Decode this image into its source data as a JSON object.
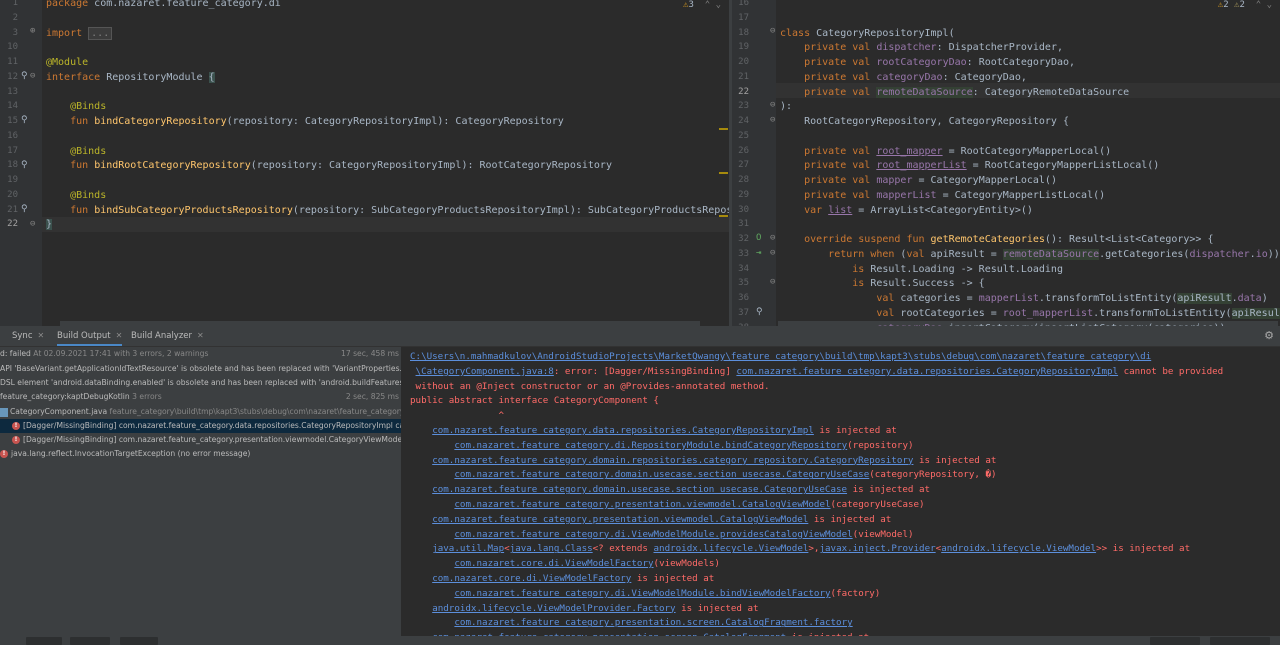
{
  "left_editor": {
    "inspection": {
      "count": "3"
    },
    "lines": [
      {
        "num": "1",
        "html": "<span class=\"kw\">package </span>com.nazaret.feature_category.di"
      },
      {
        "num": "2",
        "html": ""
      },
      {
        "num": "3",
        "html": "<span class=\"kw\">import </span><span class=\"fold\">...</span>"
      },
      {
        "num": "10",
        "html": ""
      },
      {
        "num": "11",
        "html": "<span class=\"ann\">@Module</span>"
      },
      {
        "num": "12",
        "html": "<span class=\"kw\">interface </span>RepositoryModule <span class=\"bracehl\">{</span>"
      },
      {
        "num": "13",
        "html": ""
      },
      {
        "num": "14",
        "html": "    <span class=\"ann\">@Binds</span>"
      },
      {
        "num": "15",
        "html": "    <span class=\"kw\">fun </span><span class=\"fn\">bindCategoryRepository</span>(repository: CategoryRepositoryImpl): CategoryRepository"
      },
      {
        "num": "16",
        "html": ""
      },
      {
        "num": "17",
        "html": "    <span class=\"ann\">@Binds</span>"
      },
      {
        "num": "18",
        "html": "    <span class=\"kw\">fun </span><span class=\"fn\">bindRootCategoryRepository</span>(repository: CategoryRepositoryImpl): RootCategoryRepository"
      },
      {
        "num": "19",
        "html": ""
      },
      {
        "num": "20",
        "html": "    <span class=\"ann\">@Binds</span>"
      },
      {
        "num": "21",
        "html": "    <span class=\"kw\">fun </span><span class=\"fn\">bindSubCategoryProductsRepository</span>(repository: SubCategoryProductsRepositoryImpl): SubCategoryProductsRepository"
      },
      {
        "num": "22",
        "html": "<span class=\"bracehl\">}</span>"
      }
    ]
  },
  "right_editor": {
    "inspection": {
      "warnings": "2",
      "weak_warnings": "2"
    },
    "lines": [
      {
        "num": "16",
        "html": ""
      },
      {
        "num": "17",
        "html": ""
      },
      {
        "num": "18",
        "html": "<span class=\"kw\">class </span>CategoryRepositoryImpl("
      },
      {
        "num": "19",
        "html": "    <span class=\"kw\">private val </span><span class=\"prop\">dispatcher</span>: DispatcherProvider,"
      },
      {
        "num": "20",
        "html": "    <span class=\"kw\">private val </span><span class=\"prop\">rootCategoryDao</span>: RootCategoryDao,"
      },
      {
        "num": "21",
        "html": "    <span class=\"kw\">private val </span><span class=\"prop\">categoryDao</span>: CategoryDao,"
      },
      {
        "num": "22",
        "html": "    <span class=\"kw\">private val </span><span class=\"prop hl\">remoteDataSource</span>: CategoryRemoteDataSource"
      },
      {
        "num": "23",
        "html": "):"
      },
      {
        "num": "24",
        "html": "    RootCategoryRepository, CategoryRepository {"
      },
      {
        "num": "25",
        "html": ""
      },
      {
        "num": "26",
        "html": "    <span class=\"kw\">private val </span><span class=\"prop ul\">root_mapper</span> = RootCategoryMapperLocal()"
      },
      {
        "num": "27",
        "html": "    <span class=\"kw\">private val </span><span class=\"prop ul\">root_mapperList</span> = RootCategoryMapperListLocal()"
      },
      {
        "num": "28",
        "html": "    <span class=\"kw\">private val </span><span class=\"prop\">mapper</span> = CategoryMapperLocal()"
      },
      {
        "num": "29",
        "html": "    <span class=\"kw\">private val </span><span class=\"prop\">mapperList</span> = CategoryMapperListLocal()"
      },
      {
        "num": "30",
        "html": "    <span class=\"kw\">var </span><span class=\"prop ul\">list</span> = ArrayList&lt;CategoryEntity&gt;()"
      },
      {
        "num": "31",
        "html": ""
      },
      {
        "num": "32",
        "html": "    <span class=\"kw\">override suspend fun </span><span class=\"fn\">getRemoteCategories</span>(): Result&lt;List&lt;Category&gt;&gt; {"
      },
      {
        "num": "33",
        "html": "        <span class=\"kw\">return when </span>(<span class=\"kw\">val </span>apiResult = <span class=\"prop hl\">remoteDataSource</span>.getCategories(<span class=\"prop\">dispatcher</span>.<span class=\"prop\">io</span>)) {"
      },
      {
        "num": "34",
        "html": "            <span class=\"kw\">is </span>Result.Loading -&gt; Result.Loading"
      },
      {
        "num": "35",
        "html": "            <span class=\"kw\">is </span>Result.Success -&gt; {"
      },
      {
        "num": "36",
        "html": "                <span class=\"kw\">val </span>categories = <span class=\"prop\">mapperList</span>.transformToListEntity(<span class=\"hl\">apiResult</span>.<span class=\"prop\">data</span>)"
      },
      {
        "num": "37",
        "html": "                <span class=\"kw\">val </span>rootCategories = <span class=\"prop\">root_mapperList</span>.transformToListEntity(<span class=\"hl\">apiResult</span>.<span class=\"prop\">data</span>"
      },
      {
        "num": "38",
        "html": "                <span class=\"prop\">categoryDao</span>.insertCategory(insertListCategory(categories))"
      }
    ]
  },
  "bottom_panel": {
    "tabs": [
      {
        "label": "Sync"
      },
      {
        "label": "Build Output"
      },
      {
        "label": "Build Analyzer"
      }
    ],
    "tree": [
      {
        "text": "d: failed",
        "meta": " At 02.09.2021 17:41 with 3 errors, 2 warnings",
        "time": "17 sec, 458 ms"
      },
      {
        "text": "API 'BaseVariant.getApplicationIdTextResource' is obsolete and has been replaced with 'VariantProperties.applicationId'"
      },
      {
        "text": "DSL element 'android.dataBinding.enabled' is obsolete and has been replaced with 'android.buildFeatures.dataBinding'"
      },
      {
        "text": "feature_category:kaptDebugKotlin",
        "meta": "  3 errors",
        "time": "2 sec, 825 ms"
      },
      {
        "text": "CategoryComponent.java",
        "meta": " feature_category\\build\\tmp\\kapt3\\stubs\\debug\\com\\nazaret\\feature_category\\di"
      },
      {
        "text": "[Dagger/MissingBinding] com.nazaret.feature_category.data.repositories.CategoryRepositoryImpl cannot be provided"
      },
      {
        "text": "[Dagger/MissingBinding] com.nazaret.feature_category.presentation.viewmodel.CategoryViewModel"
      },
      {
        "text": "java.lang.reflect.InvocationTargetException (no error message)"
      }
    ],
    "console": [
      {
        "indent": 0,
        "html": "<span class=\"lnk\">C:\\Users\\n.mahmadkulov\\AndroidStudioProjects\\MarketQwangy\\feature_category\\build\\tmp\\kapt3\\stubs\\debug\\com\\nazaret\\feature_category\\di</span>"
      },
      {
        "indent": 1,
        "html": "<span class=\"lnk\">\\CategoryComponent.java:8</span>: error: [Dagger/MissingBinding] <span class=\"lnk\">com.nazaret.feature_category.data.repositories.CategoryRepositoryImpl</span> cannot be provided"
      },
      {
        "indent": 1,
        "html": "without an @Inject constructor or an @Provides-annotated method."
      },
      {
        "indent": 0,
        "html": "public abstract interface CategoryComponent {"
      },
      {
        "indent": 0,
        "html": "                ^"
      },
      {
        "indent": 4,
        "html": "<span class=\"lnk\">com.nazaret.feature_category.data.repositories.CategoryRepositoryImpl</span> is injected at"
      },
      {
        "indent": 8,
        "html": "<span class=\"lnk\">com.nazaret.feature_category.di.RepositoryModule.bindCategoryRepository</span>(repository)"
      },
      {
        "indent": 4,
        "html": "<span class=\"lnk\">com.nazaret.feature_category.domain.repositories.category_repository.CategoryRepository</span> is injected at"
      },
      {
        "indent": 8,
        "html": "<span class=\"lnk\">com.nazaret.feature_category.domain.usecase.section_usecase.CategoryUseCase</span>(categoryRepository, �)"
      },
      {
        "indent": 4,
        "html": "<span class=\"lnk\">com.nazaret.feature_category.domain.usecase.section_usecase.CategoryUseCase</span> is injected at"
      },
      {
        "indent": 8,
        "html": "<span class=\"lnk\">com.nazaret.feature_category.presentation.viewmodel.CatalogViewModel</span>(categoryUseCase)"
      },
      {
        "indent": 4,
        "html": "<span class=\"lnk\">com.nazaret.feature_category.presentation.viewmodel.CatalogViewModel</span> is injected at"
      },
      {
        "indent": 8,
        "html": "<span class=\"lnk\">com.nazaret.feature_category.di.ViewModelModule.providesCatalogViewModel</span>(viewModel)"
      },
      {
        "indent": 4,
        "html": "<span class=\"lnk\">java.util.Map</span>&lt;<span class=\"lnk\">java.lang.Class</span>&lt;? extends <span class=\"lnk\">androidx.lifecycle.ViewModel</span>&gt;,<span class=\"lnk\">javax.inject.Provider</span>&lt;<span class=\"lnk\">androidx.lifecycle.ViewModel</span>&gt;&gt; is injected at"
      },
      {
        "indent": 8,
        "html": "<span class=\"lnk\">com.nazaret.core.di.ViewModelFactory</span>(viewModels)"
      },
      {
        "indent": 4,
        "html": "<span class=\"lnk\">com.nazaret.core.di.ViewModelFactory</span> is injected at"
      },
      {
        "indent": 8,
        "html": "<span class=\"lnk\">com.nazaret.feature_category.di.ViewModelModule.bindViewModelFactory</span>(factory)"
      },
      {
        "indent": 4,
        "html": "<span class=\"lnk\">androidx.lifecycle.ViewModelProvider.Factory</span> is injected at"
      },
      {
        "indent": 8,
        "html": "<span class=\"lnk\">com.nazaret.feature_category.presentation.screen.CatalogFragment.factory</span>"
      },
      {
        "indent": 4,
        "html": "<span class=\"lnk\">com.nazaret.feature_category.presentation.screen.CatalogFragment</span> is injected at"
      }
    ]
  },
  "colors": {
    "editor_bg": "#2b2b2b",
    "keyword": "#cc7832",
    "annotation": "#bbb529",
    "function": "#ffc66d",
    "property": "#9876aa",
    "error_text": "#ff6b68",
    "link": "#5c8fdc",
    "tab_underline": "#4a88c7"
  }
}
